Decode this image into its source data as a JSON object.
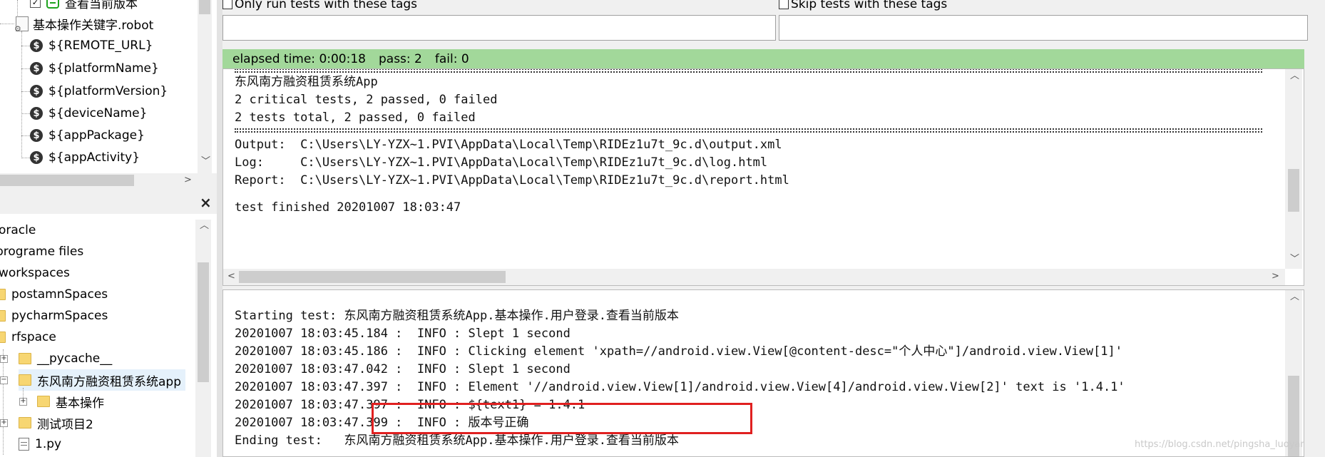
{
  "tree_top": {
    "items": [
      {
        "label": "查看当前版本"
      },
      {
        "label": "基本操作关键字.robot"
      },
      {
        "label": "${REMOTE_URL}"
      },
      {
        "label": "${platformName}"
      },
      {
        "label": "${platformVersion}"
      },
      {
        "label": "${deviceName}"
      },
      {
        "label": "${appPackage}"
      },
      {
        "label": "${appActivity}"
      }
    ]
  },
  "panel_close": "×",
  "file_tree": {
    "items": [
      {
        "label": "oracle"
      },
      {
        "label": "programe files"
      },
      {
        "label": "workspaces"
      },
      {
        "label": "postamnSpaces"
      },
      {
        "label": "pycharmSpaces"
      },
      {
        "label": "rfspace"
      },
      {
        "label": "__pycache__"
      },
      {
        "label": "东风南方融资租赁系统app"
      },
      {
        "label": "基本操作"
      },
      {
        "label": "测试项目2"
      },
      {
        "label": "1.py"
      }
    ]
  },
  "tags": {
    "only_run_label": "Only run tests with these tags",
    "skip_label": "Skip tests with these tags"
  },
  "status": {
    "elapsed": "elapsed time: 0:00:18",
    "pass": "pass: 2",
    "fail": "fail: 0"
  },
  "console_top": {
    "lines": [
      "东风南方融资租赁系统App",
      "2 critical tests, 2 passed, 0 failed",
      "2 tests total, 2 passed, 0 failed",
      "Output:  C:\\Users\\LY-YZX~1.PVI\\AppData\\Local\\Temp\\RIDEz1u7t_9c.d\\output.xml",
      "Log:     C:\\Users\\LY-YZX~1.PVI\\AppData\\Local\\Temp\\RIDEz1u7t_9c.d\\log.html",
      "Report:  C:\\Users\\LY-YZX~1.PVI\\AppData\\Local\\Temp\\RIDEz1u7t_9c.d\\report.html",
      "test finished 20201007 18:03:47"
    ]
  },
  "console_bottom": {
    "lines": [
      "Starting test: 东风南方融资租赁系统App.基本操作.用户登录.查看当前版本",
      "20201007 18:03:45.184 :  INFO : Slept 1 second",
      "20201007 18:03:45.186 :  INFO : Clicking element 'xpath=//android.view.View[@content-desc=\"个人中心\"]/android.view.View[1]'",
      "20201007 18:03:47.042 :  INFO : Slept 1 second",
      "20201007 18:03:47.397 :  INFO : Element '//android.view.View[1]/android.view.View[4]/android.view.View[2]' text is '1.4.1'",
      "20201007 18:03:47.397 :  INFO : ${text1} = 1.4.1",
      "20201007 18:03:47.399 :  INFO : 版本号正确",
      "Ending test:   东风南方融资租赁系统App.基本操作.用户登录.查看当前版本"
    ]
  },
  "watermark": "https://blog.csdn.net/pingsha_luoyan"
}
